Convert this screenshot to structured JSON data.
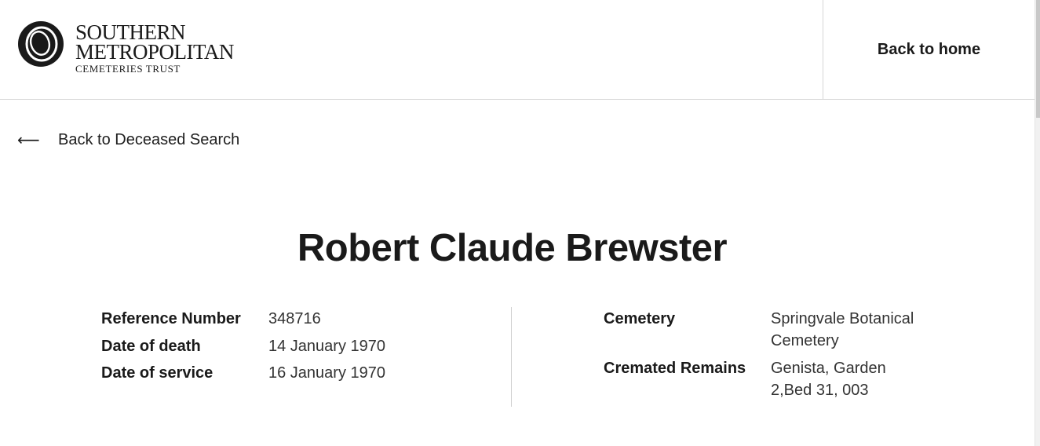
{
  "header": {
    "logo": {
      "line1": "SOUTHERN",
      "line2": "METROPOLITAN",
      "line3": "CEMETERIES TRUST"
    },
    "home_label": "Back to home"
  },
  "nav": {
    "back_label": "Back to Deceased Search",
    "back_arrow": "⟵"
  },
  "record": {
    "name": "Robert Claude Brewster",
    "left": [
      {
        "label": "Reference Number",
        "value": "348716"
      },
      {
        "label": "Date of death",
        "value": "14 January 1970"
      },
      {
        "label": "Date of service",
        "value": "16 January 1970"
      }
    ],
    "right": [
      {
        "label": "Cemetery",
        "value": "Springvale Botanical Cemetery"
      },
      {
        "label": "Cremated Remains",
        "value": "Genista, Garden 2,Bed 31, 003"
      }
    ]
  }
}
